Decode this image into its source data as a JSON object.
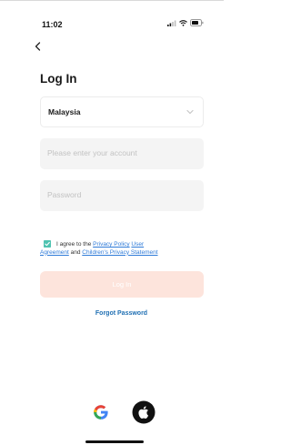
{
  "status_bar": {
    "time": "11:02"
  },
  "page": {
    "title": "Log In"
  },
  "form": {
    "region_value": "Malaysia",
    "account_placeholder": "Please enter your account",
    "password_placeholder": "Password",
    "agree": {
      "checked": true,
      "prefix": "I agree to the",
      "privacy_link": "Privacy Policy",
      "user_agreement_link_1": "User",
      "user_agreement_link_2": "Agreement",
      "and": "and",
      "children_link": "Children's Privacy Statement"
    },
    "login_label": "Log In",
    "forgot_label": "Forgot Password"
  },
  "colors": {
    "accent": "#4fc3b1",
    "link": "#2f7bd8",
    "login_disabled": "#fde4dc"
  },
  "social": [
    "google-icon",
    "apple-icon"
  ]
}
